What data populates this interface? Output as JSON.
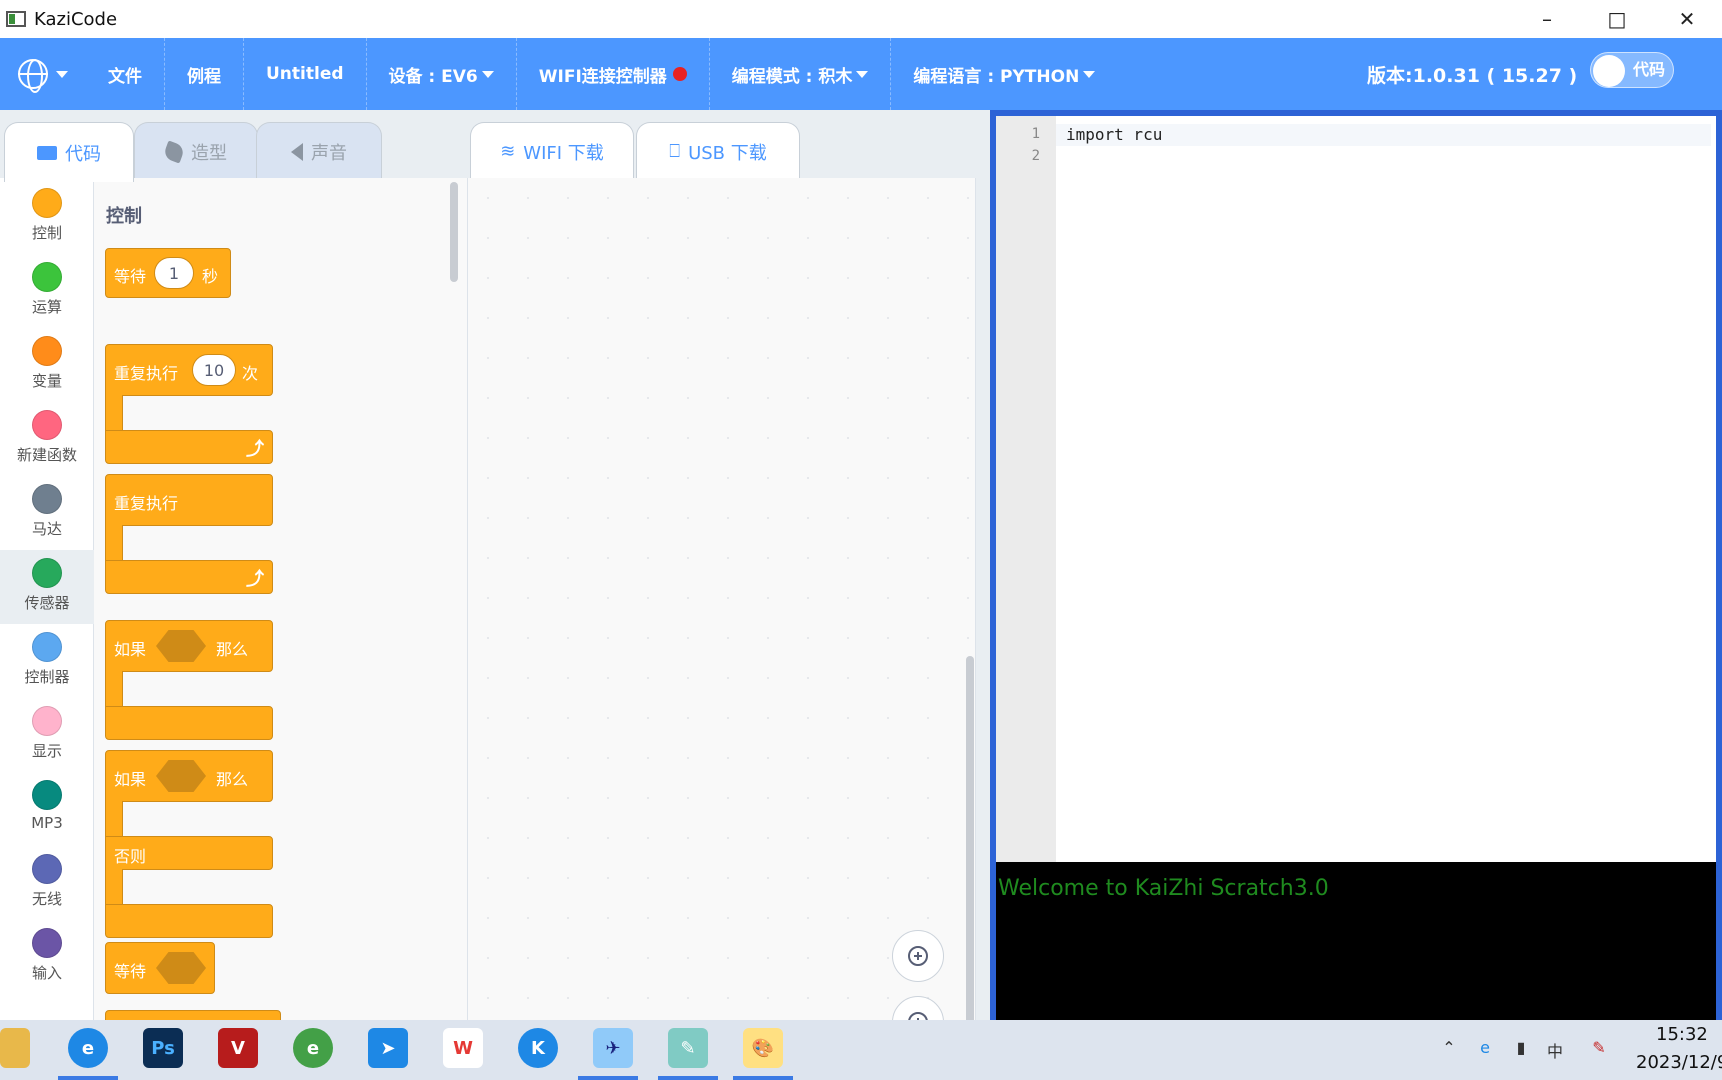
{
  "window": {
    "title": "KaziCode"
  },
  "menu": {
    "file": "文件",
    "examples": "例程",
    "project": "Untitled",
    "device": "设备 : EV6",
    "wifi": "WIFI连接控制器",
    "mode": "编程模式 : 积木",
    "language": "编程语言 : PYTHON",
    "version": "版本:1.0.31 ( 15.27 )",
    "toggle_label": "代码"
  },
  "tabs": {
    "code": "代码",
    "costume": "造型",
    "sound": "声音",
    "wifi_download": "WIFI 下载",
    "usb_download": "USB 下载"
  },
  "categories": [
    {
      "label": "控制",
      "color": "#ffab19"
    },
    {
      "label": "运算",
      "color": "#3cc43c"
    },
    {
      "label": "变量",
      "color": "#ff8c1a"
    },
    {
      "label": "新建函数",
      "color": "#ff6680"
    },
    {
      "label": "马达",
      "color": "#6f7f8f"
    },
    {
      "label": "传感器",
      "color": "#27a95c"
    },
    {
      "label": "控制器",
      "color": "#5ca8f0"
    },
    {
      "label": "显示",
      "color": "#ffb3cc"
    },
    {
      "label": "MP3",
      "color": "#078a7f"
    },
    {
      "label": "无线",
      "color": "#5c68b5"
    },
    {
      "label": "输入",
      "color": "#6b55a6"
    }
  ],
  "flyout": {
    "title": "控制",
    "wait_label": "等待",
    "wait_value": "1",
    "wait_unit": "秒",
    "repeat_label": "重复执行",
    "repeat_value": "10",
    "repeat_unit": "次",
    "forever_label": "重复执行",
    "if_label": "如果",
    "then_label": "那么",
    "if2_label": "如果",
    "then2_label": "那么",
    "else_label": "否则",
    "wait_until_label": "等待"
  },
  "editor": {
    "lines": [
      {
        "num": "1",
        "code": "import rcu"
      },
      {
        "num": "2",
        "code": ""
      }
    ]
  },
  "console": {
    "text": "Welcome to KaiZhi Scratch3.0"
  },
  "taskbar": {
    "time": "15:32",
    "date": "2023/12/9",
    "ime": "中"
  }
}
